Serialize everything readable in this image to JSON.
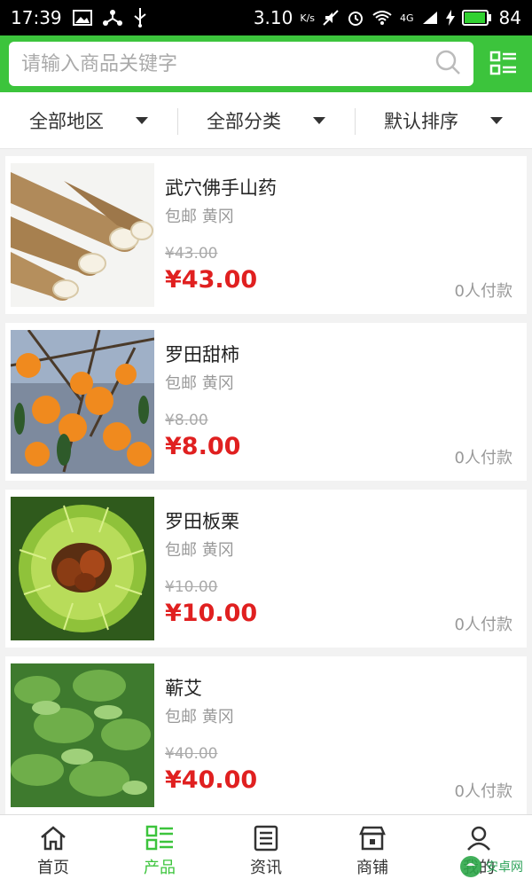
{
  "statusbar": {
    "time": "17:39",
    "speed": "3.10",
    "speed_unit": "K/s",
    "network": "4G",
    "battery": "84"
  },
  "search": {
    "placeholder": "请输入商品关键字",
    "value": ""
  },
  "filters": [
    "全部地区",
    "全部分类",
    "默认排序"
  ],
  "products": [
    {
      "title": "武穴佛手山药",
      "sub": "包邮 黄冈",
      "old_price": "¥43.00",
      "price": "¥43.00",
      "paid": "0人付款",
      "image": "yam"
    },
    {
      "title": "罗田甜柿",
      "sub": "包邮 黄冈",
      "old_price": "¥8.00",
      "price": "¥8.00",
      "paid": "0人付款",
      "image": "persimmon"
    },
    {
      "title": "罗田板栗",
      "sub": "包邮 黄冈",
      "old_price": "¥10.00",
      "price": "¥10.00",
      "paid": "0人付款",
      "image": "chestnut"
    },
    {
      "title": "蕲艾",
      "sub": "包邮 黄冈",
      "old_price": "¥40.00",
      "price": "¥40.00",
      "paid": "0人付款",
      "image": "mugwort"
    }
  ],
  "nav": [
    {
      "label": "首页",
      "icon": "home-icon"
    },
    {
      "label": "产品",
      "icon": "grid-list-icon"
    },
    {
      "label": "资讯",
      "icon": "news-icon"
    },
    {
      "label": "商铺",
      "icon": "store-icon"
    },
    {
      "label": "我的",
      "icon": "user-icon"
    }
  ],
  "watermark": "安卓网",
  "colors": {
    "brand": "#3cc43c",
    "price": "#e02020"
  }
}
